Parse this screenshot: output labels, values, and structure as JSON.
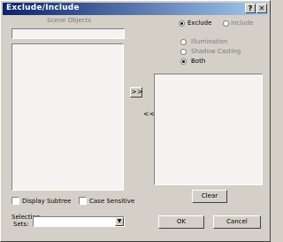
{
  "window": {
    "title": "Exclude/Include",
    "help_icon": "?",
    "close_icon": "✕"
  },
  "left": {
    "header": "Scene Objects",
    "search_value": "",
    "list_items": [],
    "combine_subtree_label": "Display Subtree",
    "case_sensitive_label": "Case Sensitive",
    "selection_sets_label_line1": "Selection",
    "selection_sets_label_line2": "Sets:",
    "selection_sets_value": ""
  },
  "middle": {
    "move_right_label": ">>",
    "move_left_label": "<<"
  },
  "right": {
    "exclude_label": "Exclude",
    "include_label": "Include",
    "mode_selected": "Exclude",
    "illumination_label": "Illumination",
    "shadow_casting_label": "Shadow Casting",
    "both_label": "Both",
    "type_selected": "Both",
    "list_items": [],
    "clear_label": "Clear",
    "ok_label": "OK",
    "cancel_label": "Cancel"
  },
  "colors": {
    "title_bar_start": "#0a246a",
    "title_bar_end": "#a6caf0",
    "dialog_face": "#d4d0c8"
  }
}
